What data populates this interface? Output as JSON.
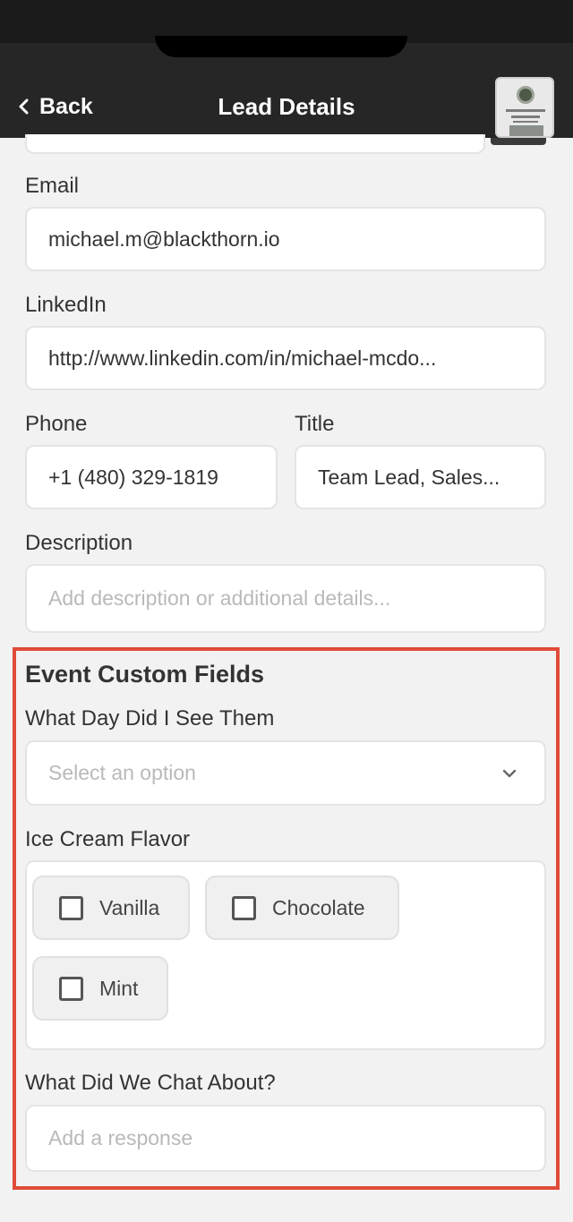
{
  "nav": {
    "back_label": "Back",
    "title": "Lead Details",
    "thumbnail_icon": "business-card-thumbnail"
  },
  "form": {
    "email": {
      "label": "Email",
      "value": "michael.m@blackthorn.io"
    },
    "linkedin": {
      "label": "LinkedIn",
      "value": "http://www.linkedin.com/in/michael-mcdo..."
    },
    "phone": {
      "label": "Phone",
      "value": "+1 (480) 329-1819"
    },
    "title": {
      "label": "Title",
      "value": "Team Lead, Sales..."
    },
    "description": {
      "label": "Description",
      "placeholder": "Add description or additional details..."
    }
  },
  "custom_fields": {
    "section_title": "Event Custom Fields",
    "highlight_color": "#e04b37",
    "day_seen": {
      "label": "What Day Did I See Them",
      "placeholder": "Select an option"
    },
    "ice_cream": {
      "label": "Ice Cream Flavor",
      "options": [
        {
          "label": "Vanilla",
          "checked": false
        },
        {
          "label": "Chocolate",
          "checked": false
        },
        {
          "label": "Mint",
          "checked": false
        }
      ]
    },
    "chat": {
      "label": "What Did We Chat About?",
      "placeholder": "Add a response"
    }
  }
}
